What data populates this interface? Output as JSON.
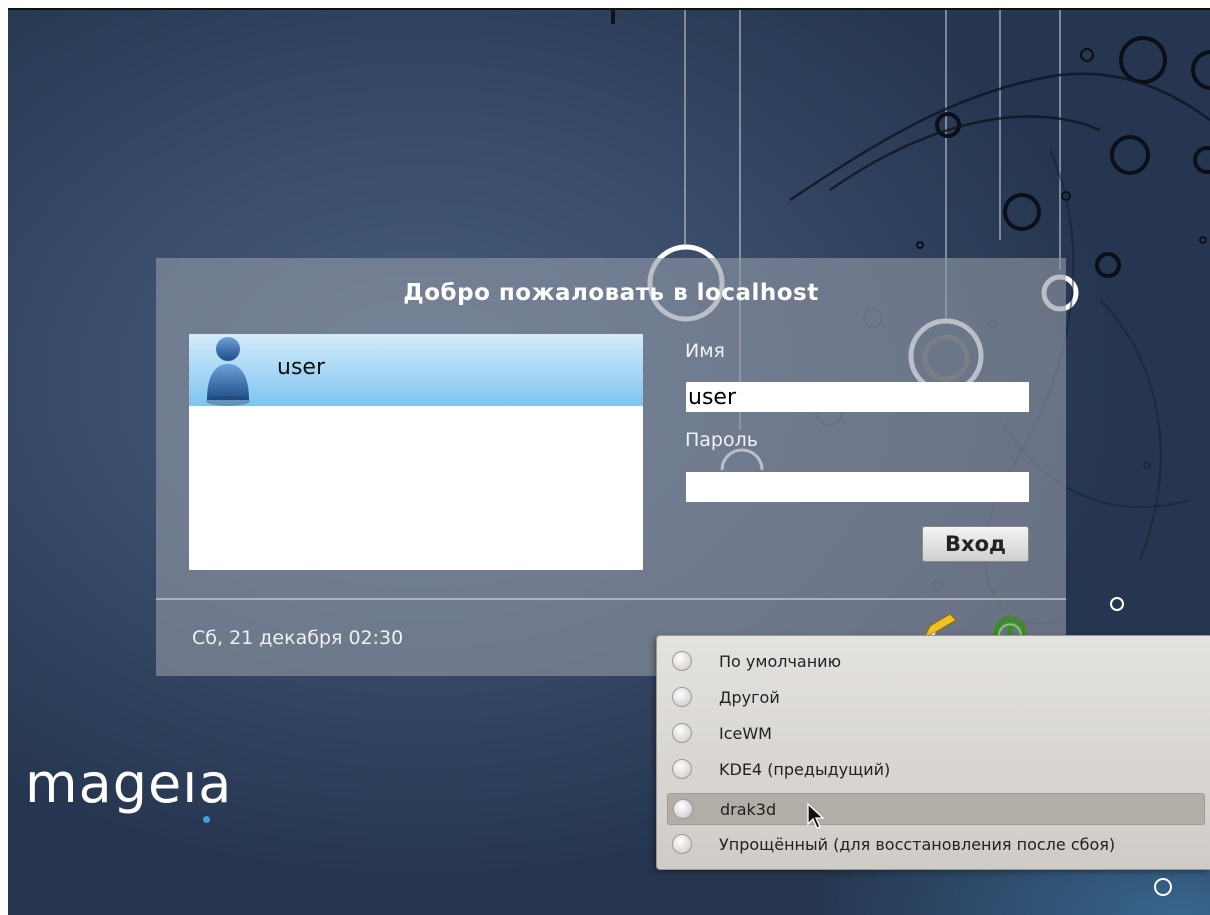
{
  "login": {
    "title": "Добро пожаловать в localhost",
    "users": [
      {
        "name": "user"
      }
    ],
    "username_label": "Имя",
    "username_value": "user",
    "password_label": "Пароль",
    "password_value": "",
    "login_button": "Вход",
    "datetime": "Сб, 21 декабря 02:30"
  },
  "branding": {
    "logo_text": "mageıa",
    "accent": "#3fa0e0"
  },
  "session_menu": {
    "items": [
      {
        "label": "По умолчанию"
      },
      {
        "label": "Другой"
      },
      {
        "label": "IceWM"
      },
      {
        "label": "KDE4 (предыдущий)"
      },
      {
        "label": "drak3d"
      },
      {
        "label": "Упрощённый (для восстановления после сбоя)"
      }
    ],
    "hovered_item": "drak3d"
  },
  "icons": {
    "session": "pencil-icon",
    "power": "power-icon",
    "user_avatar": "user-avatar-icon"
  }
}
